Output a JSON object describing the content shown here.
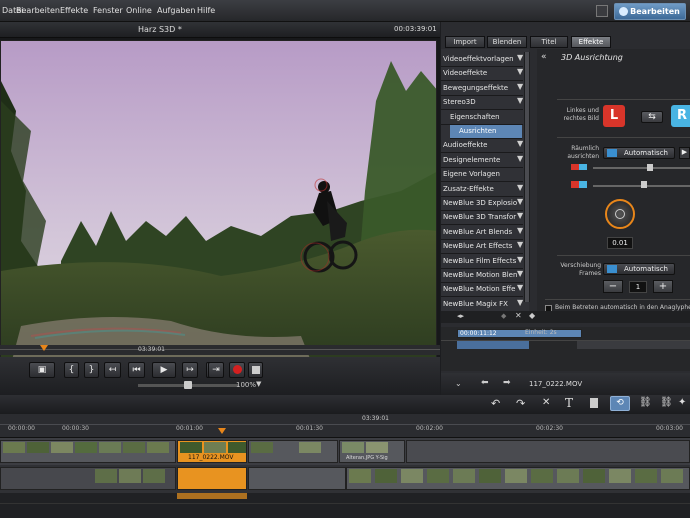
{
  "menu": {
    "items": [
      "Datei",
      "Bearbeiten",
      "Effekte",
      "Fenster",
      "Online",
      "Aufgaben",
      "Hilfe"
    ],
    "edit_button": "Bearbeiten"
  },
  "monitor": {
    "title": "Harz S3D *",
    "timecode": "00:03:39:01",
    "ruler_time": "03:39:01",
    "zoom": "100%"
  },
  "tabs": [
    "Import",
    "Blenden",
    "Titel",
    "Effekte"
  ],
  "effects_list": [
    {
      "label": "Videoeffektvorlagen",
      "arrow": true
    },
    {
      "label": "Videoeffekte",
      "arrow": true
    },
    {
      "label": "Bewegungseffekte",
      "arrow": true
    },
    {
      "label": "Stereo3D",
      "arrow": true
    },
    {
      "label": "Eigenschaften",
      "sub": true
    },
    {
      "label": "Ausrichten",
      "sub": true,
      "selected": true
    },
    {
      "label": "Audioeffekte",
      "arrow": true
    },
    {
      "label": "Designelemente",
      "arrow": true
    },
    {
      "label": "Eigene Vorlagen"
    },
    {
      "label": "Zusatz-Effekte",
      "arrow": true
    },
    {
      "label": "NewBlue 3D Explosio",
      "arrow": true
    },
    {
      "label": "NewBlue 3D Transfor",
      "arrow": true
    },
    {
      "label": "NewBlue Art Blends",
      "arrow": true
    },
    {
      "label": "NewBlue Art Effects",
      "arrow": true
    },
    {
      "label": "NewBlue Film Effects",
      "arrow": true
    },
    {
      "label": "NewBlue Motion Blen",
      "arrow": true
    },
    {
      "label": "NewBlue Motion Effe",
      "arrow": true
    },
    {
      "label": "NewBlue Magix FX",
      "arrow": true
    }
  ],
  "settings": {
    "title": "3D Ausrichtung",
    "lr_label": "Linkes und rechtes Bild",
    "left_letter": "L",
    "right_letter": "R",
    "spatial_label": "Räumlich ausrichten",
    "auto_label": "Automatisch",
    "dial_value": "0.01",
    "frames_label": "Verschiebung Frames",
    "frames_auto": "Automatisch",
    "minus": "−",
    "frame_value": "1",
    "plus": "+",
    "checkbox_label": "Beim Betreten automatisch in den Anaglyphen-Modus schalten"
  },
  "mini_timeline": {
    "time": "00:00:11:12",
    "unit": "Einheit: 2s"
  },
  "file_label": "117_0222.MOV",
  "timeline": {
    "ruler_top": "03:39:01",
    "marks": [
      "00:00:00",
      "00:00:30",
      "00:01:00",
      "00:01:30",
      "00:02:00",
      "00:02:30",
      "00:03:00"
    ],
    "clip_a": "117_0222.MOV",
    "clip_b": "Alteran.JPG  Y-Sig"
  },
  "colors": {
    "accent_blue": "#5d86b5",
    "orange_clip": "#e89320",
    "record_red": "#d42020",
    "l_red": "#d8352a",
    "r_blue": "#49b4e3"
  }
}
